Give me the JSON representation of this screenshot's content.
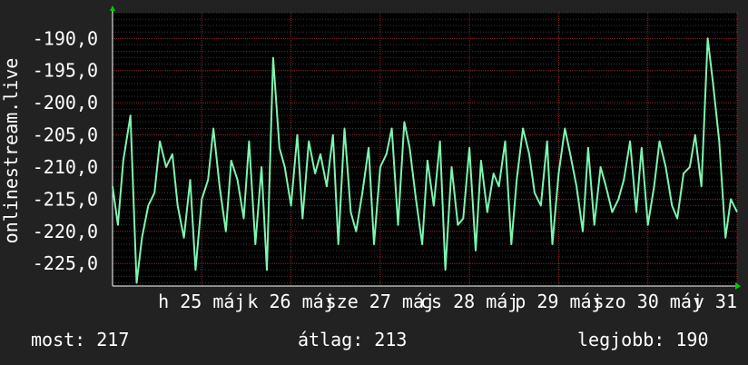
{
  "chart_data": {
    "type": "line",
    "ylabel": "onlinestream.live",
    "y_ticks": [
      "-190,0",
      "-195,0",
      "-200,0",
      "-205,0",
      "-210,0",
      "-215,0",
      "-220,0",
      "-225,0"
    ],
    "y_tick_values": [
      -190,
      -195,
      -200,
      -205,
      -210,
      -215,
      -220,
      -225
    ],
    "ylim": [
      -228.5,
      -186
    ],
    "x_ticks": [
      "h 25 máj",
      "k 26 máj",
      "sze 27 máj",
      "cs 28 máj",
      "p 29 máj",
      "szo 30 máj",
      "v 31 máj"
    ],
    "xlim": [
      0,
      7
    ],
    "grid": true,
    "series": [
      {
        "color": "#7df5b0",
        "x": [
          0.0,
          0.06,
          0.12,
          0.2,
          0.27,
          0.33,
          0.4,
          0.47,
          0.53,
          0.6,
          0.67,
          0.73,
          0.8,
          0.87,
          0.93,
          1.0,
          1.07,
          1.13,
          1.2,
          1.27,
          1.33,
          1.4,
          1.47,
          1.53,
          1.6,
          1.67,
          1.73,
          1.8,
          1.87,
          1.93,
          2.0,
          2.07,
          2.13,
          2.2,
          2.27,
          2.33,
          2.4,
          2.47,
          2.53,
          2.6,
          2.67,
          2.73,
          2.8,
          2.87,
          2.93,
          3.0,
          3.07,
          3.13,
          3.2,
          3.27,
          3.33,
          3.4,
          3.47,
          3.53,
          3.6,
          3.67,
          3.73,
          3.8,
          3.87,
          3.93,
          4.0,
          4.07,
          4.13,
          4.2,
          4.27,
          4.33,
          4.4,
          4.47,
          4.53,
          4.6,
          4.67,
          4.73,
          4.8,
          4.87,
          4.93,
          5.0,
          5.07,
          5.13,
          5.2,
          5.27,
          5.33,
          5.4,
          5.47,
          5.53,
          5.6,
          5.67,
          5.73,
          5.8,
          5.87,
          5.93,
          6.0,
          6.07,
          6.13,
          6.2,
          6.27,
          6.33,
          6.4,
          6.47,
          6.53,
          6.6,
          6.67,
          6.73,
          6.8,
          6.87,
          6.93,
          7.0
        ],
        "values": [
          -213,
          -219,
          -209,
          -202,
          -228,
          -221,
          -216,
          -214,
          -206,
          -210,
          -208,
          -216,
          -221,
          -212,
          -226,
          -215,
          -212,
          -204,
          -213,
          -220,
          -209,
          -212,
          -218,
          -206,
          -222,
          -210,
          -226,
          -193,
          -207,
          -210,
          -216,
          -205,
          -218,
          -206,
          -211,
          -208,
          -213,
          -205,
          -222,
          -204,
          -217,
          -220,
          -214,
          -207,
          -222,
          -210,
          -208,
          -204,
          -219,
          -203,
          -207,
          -215,
          -222,
          -209,
          -216,
          -206,
          -226,
          -210,
          -219,
          -218,
          -207,
          -223,
          -209,
          -217,
          -211,
          -213,
          -206,
          -222,
          -212,
          -204,
          -208,
          -214,
          -216,
          -206,
          -222,
          -211,
          -204,
          -208,
          -213,
          -220,
          -207,
          -219,
          -210,
          -213,
          -217,
          -215,
          -212,
          -206,
          -217,
          -207,
          -219,
          -213,
          -206,
          -210,
          -216,
          -218,
          -211,
          -210,
          -205,
          -213,
          -190,
          -197,
          -206,
          -221,
          -215,
          -217
        ]
      }
    ],
    "stats": {
      "now_label": "most:",
      "now_value": "217",
      "avg_label": "átlag:",
      "avg_value": "213",
      "max_label": "legjobb:",
      "max_value": "190"
    }
  }
}
